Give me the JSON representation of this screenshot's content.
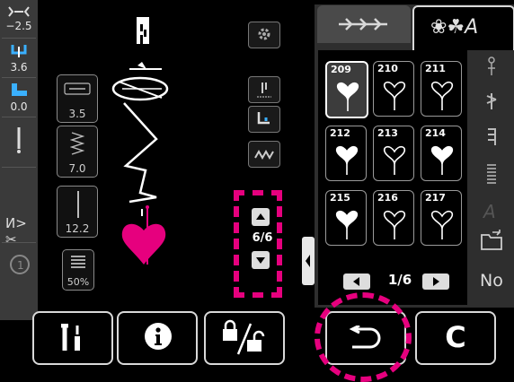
{
  "left_column": {
    "stitch_width": "−2.5",
    "stitch_length": "3.6",
    "presser_foot": "0.0",
    "thread_cutter": "",
    "tie_off": ""
  },
  "params": {
    "stitch_width_value": "3.5",
    "stitch_length_value": "7.0",
    "needle_position_value": "12.2",
    "tension_value": "50%"
  },
  "stitch_counter": {
    "value": "6/6"
  },
  "tabs": {
    "active": "symbols-tab"
  },
  "patterns": [
    {
      "number": "209",
      "selected": true
    },
    {
      "number": "210",
      "selected": false
    },
    {
      "number": "211",
      "selected": false
    },
    {
      "number": "212",
      "selected": false
    },
    {
      "number": "213",
      "selected": false
    },
    {
      "number": "214",
      "selected": false
    },
    {
      "number": "215",
      "selected": false
    },
    {
      "number": "216",
      "selected": false
    },
    {
      "number": "217",
      "selected": false
    }
  ],
  "pager": {
    "page": "1/6"
  },
  "side_tools": {
    "no_label": "No"
  },
  "colors": {
    "accent": "#e6007e",
    "panel": "#3a3a3a",
    "border": "#d9d9d9"
  }
}
